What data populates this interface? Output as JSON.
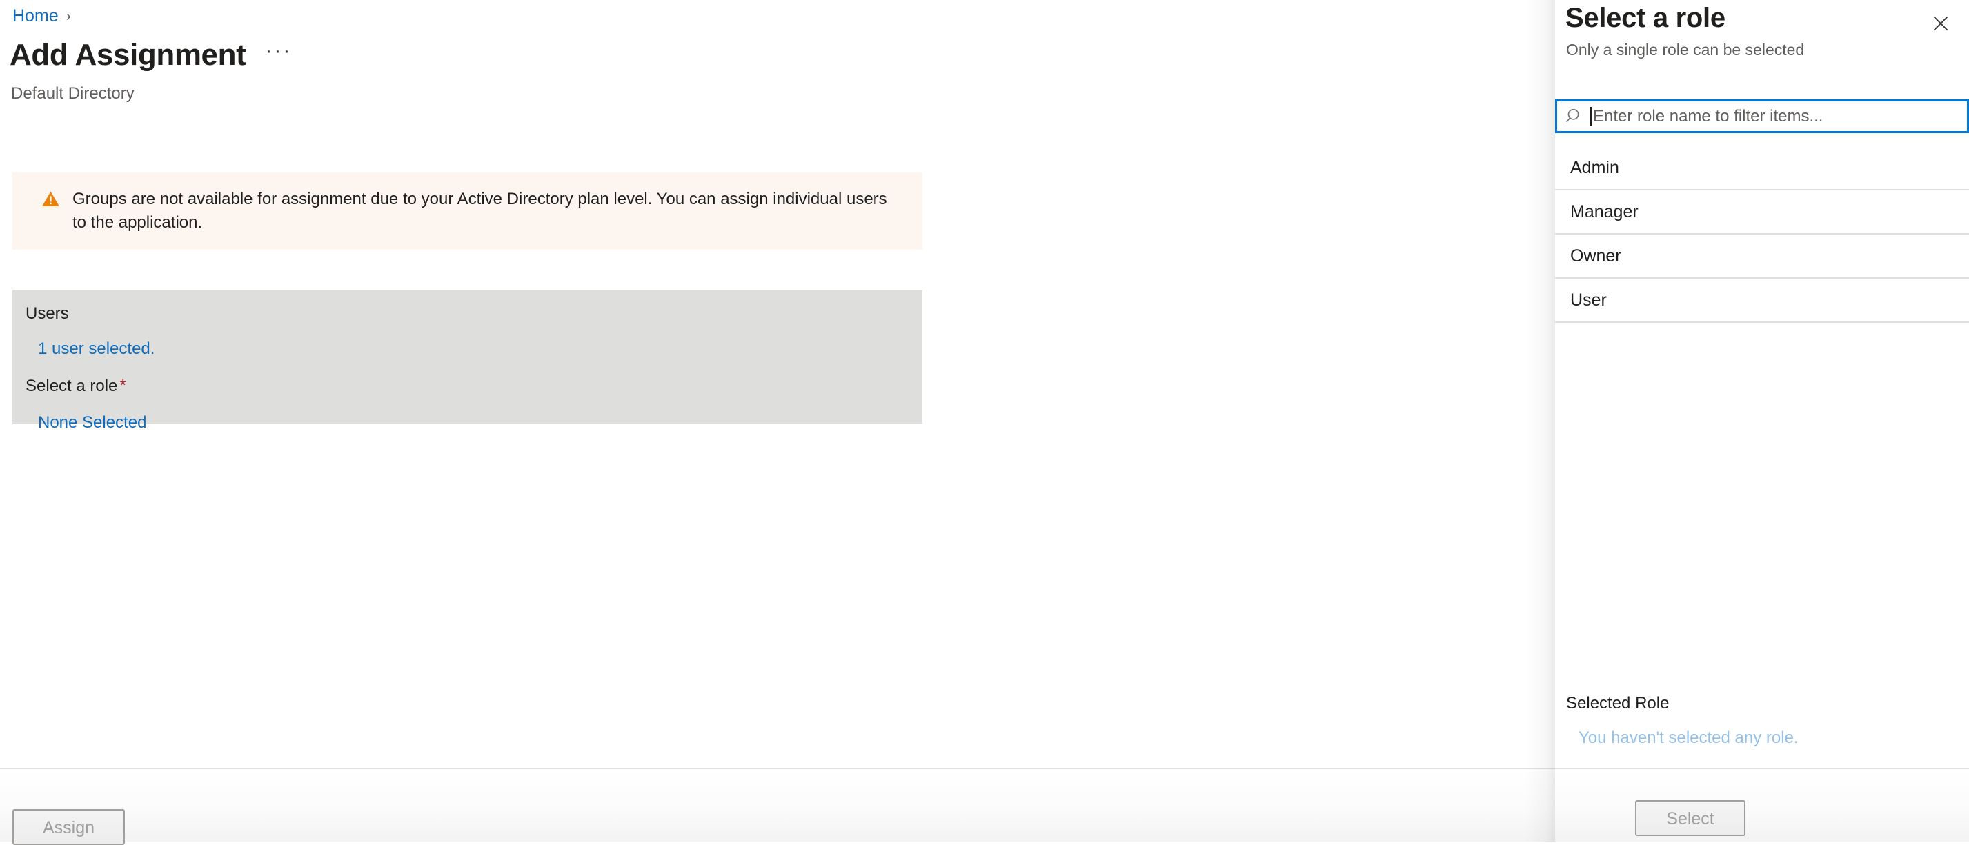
{
  "breadcrumb": {
    "home_label": "Home",
    "separator": "›"
  },
  "header": {
    "title": "Add Assignment",
    "more_menu_label": "···",
    "subtitle": "Default Directory"
  },
  "warning": {
    "icon": "warning-triangle-icon",
    "message": "Groups are not available for assignment due to your Active Directory plan level. You can assign individual users to the application.",
    "background_color": "#fdf6f0",
    "icon_color": "#e8820c"
  },
  "form": {
    "background_color": "#dededc",
    "users_label": "Users",
    "users_value": "1 user selected.",
    "role_label": "Select a role",
    "role_required_marker": "*",
    "role_value": "None Selected",
    "link_color": "#0f6cbd",
    "required_color": "#a4262c"
  },
  "footer": {
    "assign_label": "Assign"
  },
  "pane": {
    "title": "Select a role",
    "subtitle": "Only a single role can be selected",
    "close_icon": "close-icon",
    "search": {
      "icon": "search-icon",
      "placeholder": "Enter role name to filter items...",
      "value": "",
      "focus_border_color": "#0078d4"
    },
    "roles": [
      {
        "label": "Admin"
      },
      {
        "label": "Manager"
      },
      {
        "label": "Owner"
      },
      {
        "label": "User"
      }
    ],
    "selected_role": {
      "label": "Selected Role",
      "empty_message": "You haven't selected any role.",
      "empty_color": "#94c0e7"
    },
    "select_button_label": "Select"
  }
}
